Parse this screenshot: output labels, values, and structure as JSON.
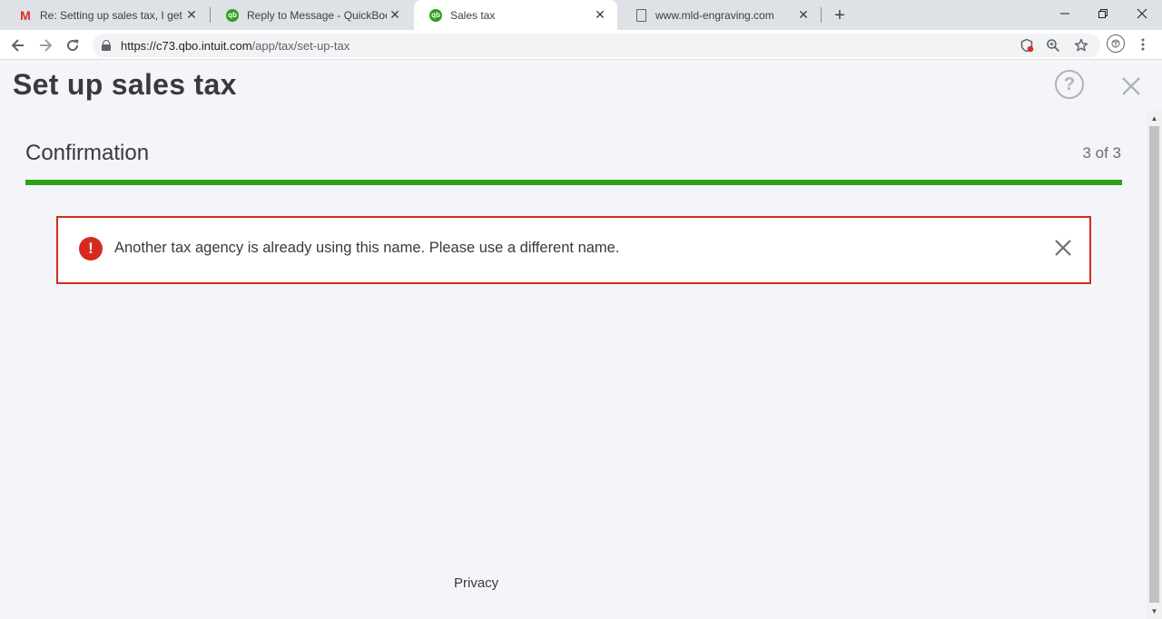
{
  "browser": {
    "tabs": [
      {
        "title": "Re: Setting up sales tax, I get the",
        "favicon": "gmail-icon",
        "active": false
      },
      {
        "title": "Reply to Message - QuickBooks C",
        "favicon": "quickbooks-icon",
        "active": false
      },
      {
        "title": "Sales tax",
        "favicon": "quickbooks-icon",
        "active": true
      },
      {
        "title": "www.mld-engraving.com",
        "favicon": "document-icon",
        "active": false
      }
    ],
    "tab_close_glyph": "✕",
    "new_tab_glyph": "+",
    "url_host": "https://c73.qbo.intuit.com",
    "url_path": "/app/tax/set-up-tax"
  },
  "page": {
    "title": "Set up sales tax",
    "help_glyph": "?",
    "step_title": "Confirmation",
    "step_count": "3 of 3",
    "progress_fraction": 1.0,
    "colors": {
      "progress": "#2ca01c",
      "error": "#d52b1e"
    }
  },
  "alert": {
    "icon_glyph": "!",
    "message": "Another tax agency is already using this name. Please use a different name."
  },
  "footer": {
    "privacy_label": "Privacy"
  }
}
